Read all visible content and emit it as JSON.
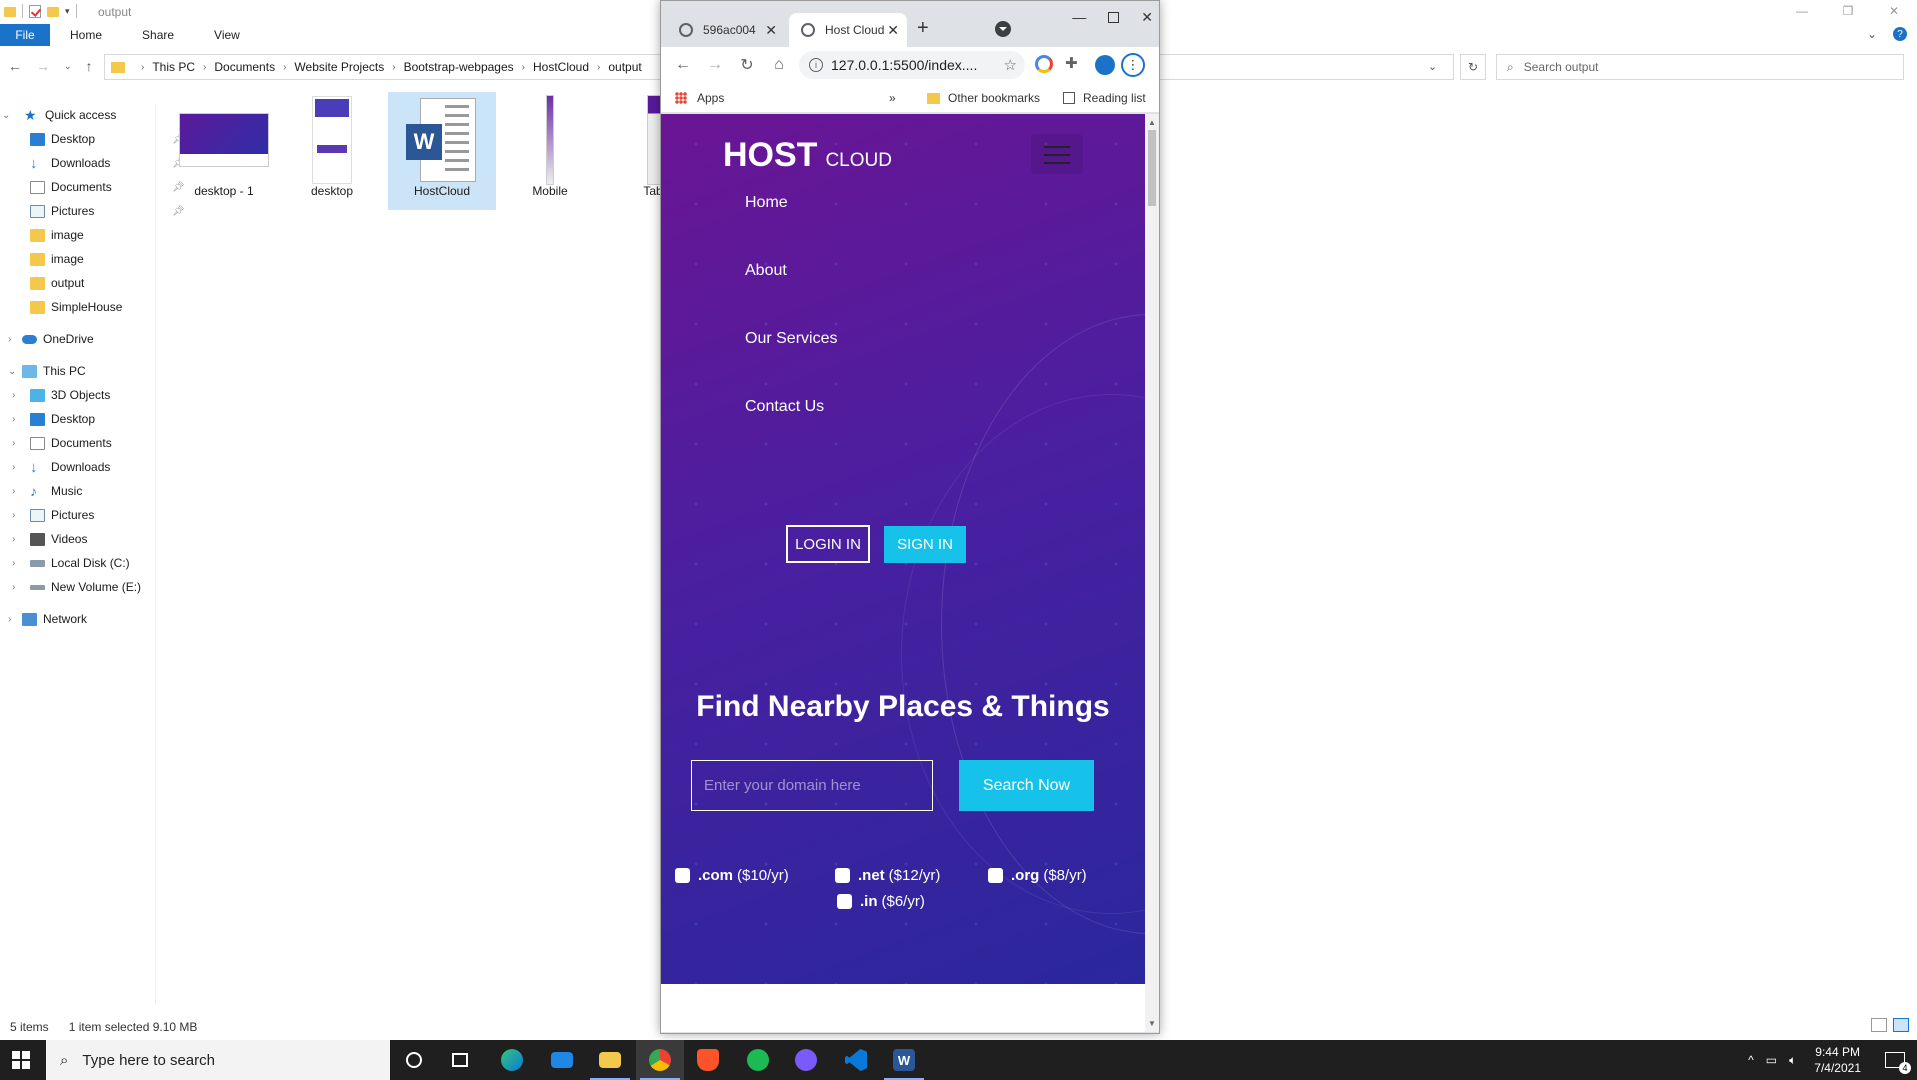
{
  "explorer": {
    "title": "output",
    "ribbon_tabs": [
      "File",
      "Home",
      "Share",
      "View"
    ],
    "breadcrumb": [
      "This PC",
      "Documents",
      "Website Projects",
      "Bootstrap-webpages",
      "HostCloud",
      "output"
    ],
    "search_placeholder": "Search output",
    "nav": {
      "quick_access": "Quick access",
      "qa_items": [
        "Desktop",
        "Downloads",
        "Documents",
        "Pictures",
        "image",
        "image",
        "output",
        "SimpleHouse"
      ],
      "onedrive": "OneDrive",
      "this_pc": "This PC",
      "pc_items": [
        "3D Objects",
        "Desktop",
        "Documents",
        "Downloads",
        "Music",
        "Pictures",
        "Videos",
        "Local Disk (C:)",
        "New Volume (E:)"
      ],
      "network": "Network"
    },
    "files": [
      "desktop - 1",
      "desktop",
      "HostCloud",
      "Mobile",
      "Tab"
    ],
    "status": {
      "count": "5 items",
      "selection": "1 item selected  9.10 MB"
    }
  },
  "chrome": {
    "tabs": [
      {
        "title": "596ac004"
      },
      {
        "title": "Host Cloud"
      }
    ],
    "url": "127.0.0.1:5500/index....",
    "bookmarks": {
      "apps": "Apps",
      "more": "»",
      "other": "Other bookmarks",
      "reading": "Reading list"
    }
  },
  "site": {
    "brand_main": "HOST",
    "brand_sub": "CLOUD",
    "nav": [
      "Home",
      "About",
      "Our Services",
      "Contact Us"
    ],
    "login": "LOGIN IN",
    "signin": "SIGN IN",
    "headline": "Find Nearby Places & Things",
    "domain_placeholder": "Enter your domain here",
    "search_button": "Search Now",
    "tlds": [
      {
        "ext": ".com",
        "price": "($10/yr)"
      },
      {
        "ext": ".net",
        "price": "($12/yr)"
      },
      {
        "ext": ".org",
        "price": "($8/yr)"
      },
      {
        "ext": ".in",
        "price": "($6/yr)"
      }
    ]
  },
  "taskbar": {
    "search_placeholder": "Type here to search",
    "time": "9:44 PM",
    "date": "7/4/2021",
    "notifications": "4"
  }
}
